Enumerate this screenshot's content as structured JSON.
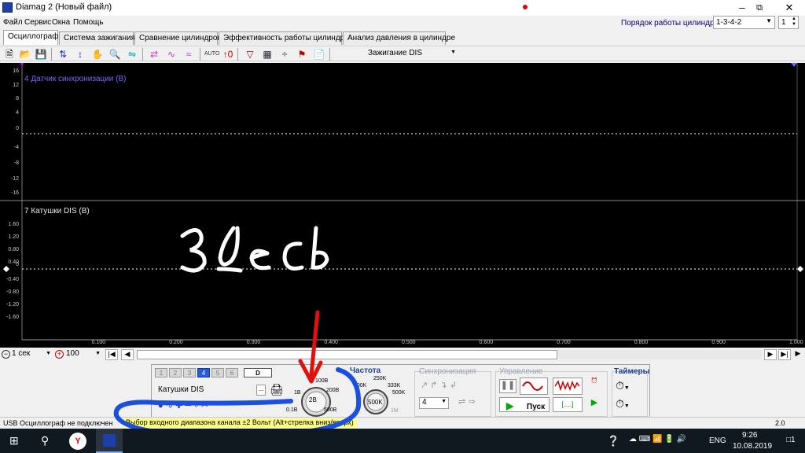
{
  "window": {
    "title": "Diamag 2 (Новый файл)"
  },
  "menu": [
    "Файл",
    "Сервис",
    "Окна",
    "Помощь"
  ],
  "cylinders": {
    "label": "Порядок работы цилиндров",
    "order": "1-3-4-2",
    "spin": "1"
  },
  "tabs": [
    "Осциллограф",
    "Система зажигания",
    "Сравнение цилиндров",
    "Эффективность работы цилиндров",
    "Анализ давления в цилиндре"
  ],
  "toolbar": {
    "mode": "Зажигание DIS",
    "auto_label": "AUTO"
  },
  "channels": {
    "top": {
      "label": "4 Датчик синхронизации (В)",
      "ticks": [
        "16",
        "12",
        "8",
        "4",
        "0",
        "-4",
        "-8",
        "-12",
        "-16"
      ],
      "color": "#6a6aff"
    },
    "bottom": {
      "label": "7 Катушки DIS (В)",
      "ticks": [
        "1.60",
        "1.20",
        "0.80",
        "0.40",
        "0",
        "-0.40",
        "-0.80",
        "-1.20",
        "-1.60"
      ],
      "color": "#e8e8e8"
    }
  },
  "xaxis": [
    "0.100",
    "0.200",
    "0.300",
    "0.400",
    "0.500",
    "0.600",
    "0.700",
    "0.800",
    "0.900",
    "1.000"
  ],
  "scrollbar": {
    "timebase": "1 сек",
    "zoom": "100"
  },
  "control_panel": {
    "channel_buttons": [
      "1",
      "2",
      "3",
      "4",
      "5",
      "6",
      "D"
    ],
    "channel_name": "Катушки DIS",
    "voltage_knob": {
      "value": "2В",
      "labels": [
        "1В",
        "100В",
        "200В",
        "500В",
        "0.1В"
      ]
    },
    "freq": {
      "title": "Частота",
      "value": "500K",
      "labels": [
        "100K",
        "250K",
        "333K",
        "500K",
        "1M"
      ]
    },
    "sync": {
      "title": "Синхронизация",
      "channel": "4"
    },
    "control": {
      "title": "Управление",
      "start": "Пуск",
      "single": "[....]"
    },
    "timers": {
      "title": "Таймеры"
    }
  },
  "status": {
    "usb": "USB Осциллограф не подключен",
    "hint": "Выбор входного диапазона канала ±2 Вольт  (Alt+стрелка вниз/вверх)",
    "version": "2.0"
  },
  "annotation": {
    "text": "здесь"
  },
  "taskbar": {
    "lang": "ENG",
    "time": "9:26",
    "date": "10.08.2019",
    "notif": "1"
  }
}
